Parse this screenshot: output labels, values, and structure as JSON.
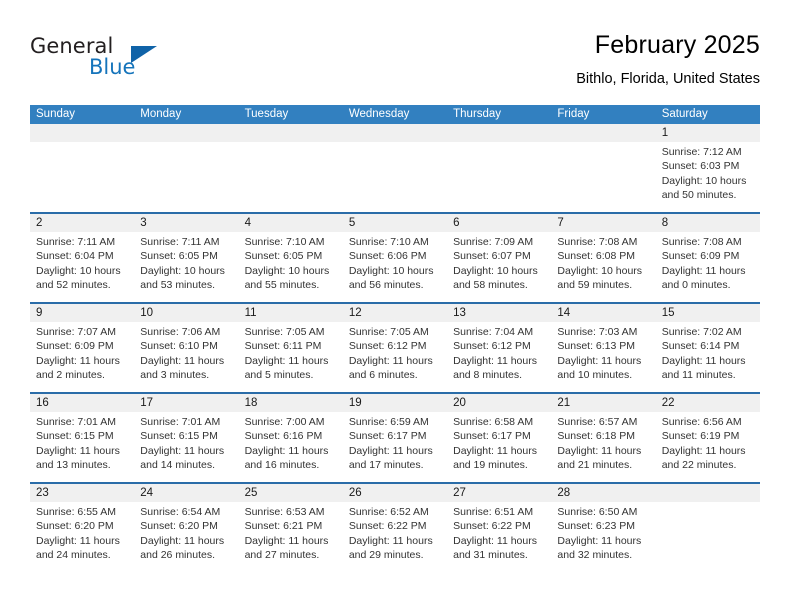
{
  "brand": {
    "name_part1": "General",
    "name_part2": "Blue",
    "triangle_color": "#1063a8",
    "blue_color": "#1574bb"
  },
  "header": {
    "title": "February 2025",
    "location": "Bithlo, Florida, United States"
  },
  "theme": {
    "header_bg": "#3280c0",
    "row_divider": "#2a6ca8",
    "daynum_bg": "#f0f0f0"
  },
  "weekdays": [
    "Sunday",
    "Monday",
    "Tuesday",
    "Wednesday",
    "Thursday",
    "Friday",
    "Saturday"
  ],
  "weeks": [
    {
      "days": [
        {
          "num": "",
          "lines": []
        },
        {
          "num": "",
          "lines": []
        },
        {
          "num": "",
          "lines": []
        },
        {
          "num": "",
          "lines": []
        },
        {
          "num": "",
          "lines": []
        },
        {
          "num": "",
          "lines": []
        },
        {
          "num": "1",
          "lines": [
            "Sunrise: 7:12 AM",
            "Sunset: 6:03 PM",
            "Daylight: 10 hours",
            "and 50 minutes."
          ]
        }
      ]
    },
    {
      "days": [
        {
          "num": "2",
          "lines": [
            "Sunrise: 7:11 AM",
            "Sunset: 6:04 PM",
            "Daylight: 10 hours",
            "and 52 minutes."
          ]
        },
        {
          "num": "3",
          "lines": [
            "Sunrise: 7:11 AM",
            "Sunset: 6:05 PM",
            "Daylight: 10 hours",
            "and 53 minutes."
          ]
        },
        {
          "num": "4",
          "lines": [
            "Sunrise: 7:10 AM",
            "Sunset: 6:05 PM",
            "Daylight: 10 hours",
            "and 55 minutes."
          ]
        },
        {
          "num": "5",
          "lines": [
            "Sunrise: 7:10 AM",
            "Sunset: 6:06 PM",
            "Daylight: 10 hours",
            "and 56 minutes."
          ]
        },
        {
          "num": "6",
          "lines": [
            "Sunrise: 7:09 AM",
            "Sunset: 6:07 PM",
            "Daylight: 10 hours",
            "and 58 minutes."
          ]
        },
        {
          "num": "7",
          "lines": [
            "Sunrise: 7:08 AM",
            "Sunset: 6:08 PM",
            "Daylight: 10 hours",
            "and 59 minutes."
          ]
        },
        {
          "num": "8",
          "lines": [
            "Sunrise: 7:08 AM",
            "Sunset: 6:09 PM",
            "Daylight: 11 hours",
            "and 0 minutes."
          ]
        }
      ]
    },
    {
      "days": [
        {
          "num": "9",
          "lines": [
            "Sunrise: 7:07 AM",
            "Sunset: 6:09 PM",
            "Daylight: 11 hours",
            "and 2 minutes."
          ]
        },
        {
          "num": "10",
          "lines": [
            "Sunrise: 7:06 AM",
            "Sunset: 6:10 PM",
            "Daylight: 11 hours",
            "and 3 minutes."
          ]
        },
        {
          "num": "11",
          "lines": [
            "Sunrise: 7:05 AM",
            "Sunset: 6:11 PM",
            "Daylight: 11 hours",
            "and 5 minutes."
          ]
        },
        {
          "num": "12",
          "lines": [
            "Sunrise: 7:05 AM",
            "Sunset: 6:12 PM",
            "Daylight: 11 hours",
            "and 6 minutes."
          ]
        },
        {
          "num": "13",
          "lines": [
            "Sunrise: 7:04 AM",
            "Sunset: 6:12 PM",
            "Daylight: 11 hours",
            "and 8 minutes."
          ]
        },
        {
          "num": "14",
          "lines": [
            "Sunrise: 7:03 AM",
            "Sunset: 6:13 PM",
            "Daylight: 11 hours",
            "and 10 minutes."
          ]
        },
        {
          "num": "15",
          "lines": [
            "Sunrise: 7:02 AM",
            "Sunset: 6:14 PM",
            "Daylight: 11 hours",
            "and 11 minutes."
          ]
        }
      ]
    },
    {
      "days": [
        {
          "num": "16",
          "lines": [
            "Sunrise: 7:01 AM",
            "Sunset: 6:15 PM",
            "Daylight: 11 hours",
            "and 13 minutes."
          ]
        },
        {
          "num": "17",
          "lines": [
            "Sunrise: 7:01 AM",
            "Sunset: 6:15 PM",
            "Daylight: 11 hours",
            "and 14 minutes."
          ]
        },
        {
          "num": "18",
          "lines": [
            "Sunrise: 7:00 AM",
            "Sunset: 6:16 PM",
            "Daylight: 11 hours",
            "and 16 minutes."
          ]
        },
        {
          "num": "19",
          "lines": [
            "Sunrise: 6:59 AM",
            "Sunset: 6:17 PM",
            "Daylight: 11 hours",
            "and 17 minutes."
          ]
        },
        {
          "num": "20",
          "lines": [
            "Sunrise: 6:58 AM",
            "Sunset: 6:17 PM",
            "Daylight: 11 hours",
            "and 19 minutes."
          ]
        },
        {
          "num": "21",
          "lines": [
            "Sunrise: 6:57 AM",
            "Sunset: 6:18 PM",
            "Daylight: 11 hours",
            "and 21 minutes."
          ]
        },
        {
          "num": "22",
          "lines": [
            "Sunrise: 6:56 AM",
            "Sunset: 6:19 PM",
            "Daylight: 11 hours",
            "and 22 minutes."
          ]
        }
      ]
    },
    {
      "days": [
        {
          "num": "23",
          "lines": [
            "Sunrise: 6:55 AM",
            "Sunset: 6:20 PM",
            "Daylight: 11 hours",
            "and 24 minutes."
          ]
        },
        {
          "num": "24",
          "lines": [
            "Sunrise: 6:54 AM",
            "Sunset: 6:20 PM",
            "Daylight: 11 hours",
            "and 26 minutes."
          ]
        },
        {
          "num": "25",
          "lines": [
            "Sunrise: 6:53 AM",
            "Sunset: 6:21 PM",
            "Daylight: 11 hours",
            "and 27 minutes."
          ]
        },
        {
          "num": "26",
          "lines": [
            "Sunrise: 6:52 AM",
            "Sunset: 6:22 PM",
            "Daylight: 11 hours",
            "and 29 minutes."
          ]
        },
        {
          "num": "27",
          "lines": [
            "Sunrise: 6:51 AM",
            "Sunset: 6:22 PM",
            "Daylight: 11 hours",
            "and 31 minutes."
          ]
        },
        {
          "num": "28",
          "lines": [
            "Sunrise: 6:50 AM",
            "Sunset: 6:23 PM",
            "Daylight: 11 hours",
            "and 32 minutes."
          ]
        },
        {
          "num": "",
          "lines": []
        }
      ]
    }
  ]
}
